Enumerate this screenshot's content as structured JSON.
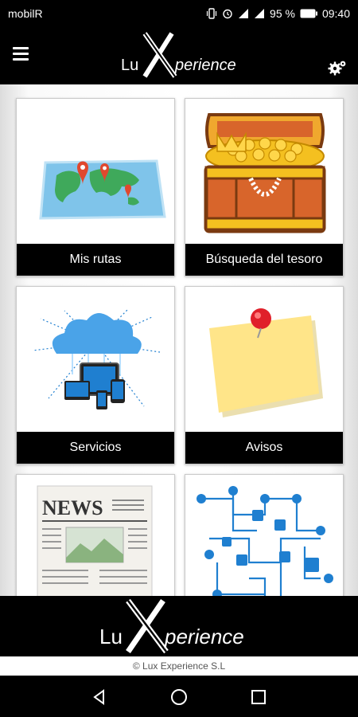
{
  "status_bar": {
    "carrier": "mobilR",
    "battery": "95 %",
    "time": "09:40",
    "icons": [
      "vibrate-icon",
      "alarm-icon",
      "4g-signal-icon",
      "signal-icon",
      "battery-icon"
    ]
  },
  "app_bar": {
    "logo_text_left": "Lu",
    "logo_text_right": "perience",
    "menu_icon": "hamburger-menu-icon",
    "settings_icon": "gears-icon"
  },
  "cards": [
    {
      "label": "Mis rutas",
      "icon": "map-icon"
    },
    {
      "label": "Búsqueda del tesoro",
      "icon": "treasure-chest-icon"
    },
    {
      "label": "Servicios",
      "icon": "cloud-devices-icon"
    },
    {
      "label": "Avisos",
      "icon": "sticky-note-icon"
    },
    {
      "label": "",
      "icon": "newspaper-icon",
      "news_text": "NEWS"
    },
    {
      "label": "",
      "icon": "social-network-icon"
    }
  ],
  "footer": {
    "logo_text_left": "Lu",
    "logo_text_right": "perience",
    "copyright": "© Lux Experience S.L"
  },
  "nav_bar": {
    "icons": [
      "back-icon",
      "home-icon",
      "recents-icon"
    ]
  },
  "colors": {
    "background": "#000000",
    "card_label_bg": "#000000",
    "map_water": "#7fc4ea",
    "map_land": "#3fa95b",
    "pin_red": "#e0482e",
    "chest_gold": "#f4c020",
    "chest_wood": "#d8652b",
    "note_yellow": "#ffe589",
    "cloud_blue": "#1f7fd0"
  }
}
